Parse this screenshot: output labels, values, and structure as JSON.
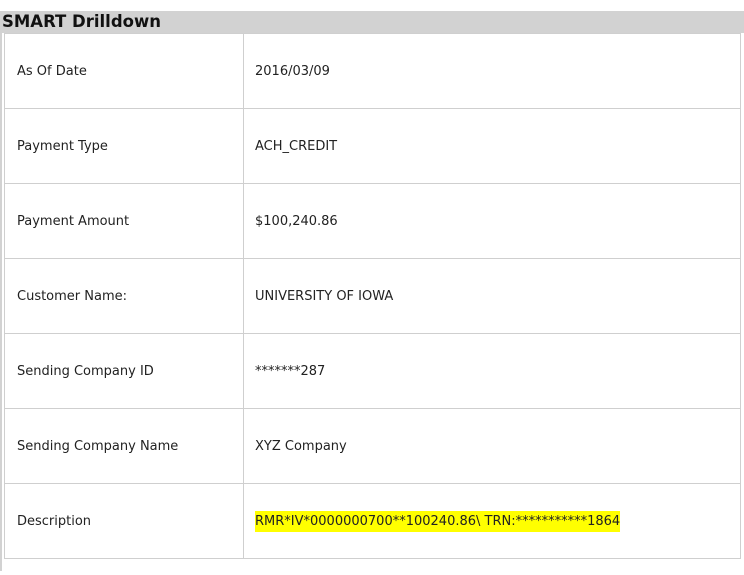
{
  "panel": {
    "title": "SMART Drilldown"
  },
  "rows": [
    {
      "label": "As Of Date",
      "value": "2016/03/09"
    },
    {
      "label": "Payment Type",
      "value": "ACH_CREDIT"
    },
    {
      "label": "Payment Amount",
      "value": "$100,240.86"
    },
    {
      "label": "Customer Name:",
      "value": "UNIVERSITY OF IOWA"
    },
    {
      "label": "Sending Company ID",
      "value": "*******287"
    },
    {
      "label": "Sending Company Name",
      "value": "XYZ Company"
    },
    {
      "label": "Description",
      "value": "RMR*IV*0000000700**100240.86\\ TRN:***********1864",
      "highlighted": true
    }
  ],
  "colors": {
    "header_background": "#d2d2d2",
    "border": "#cfcfcf",
    "highlight": "#ffff00"
  }
}
